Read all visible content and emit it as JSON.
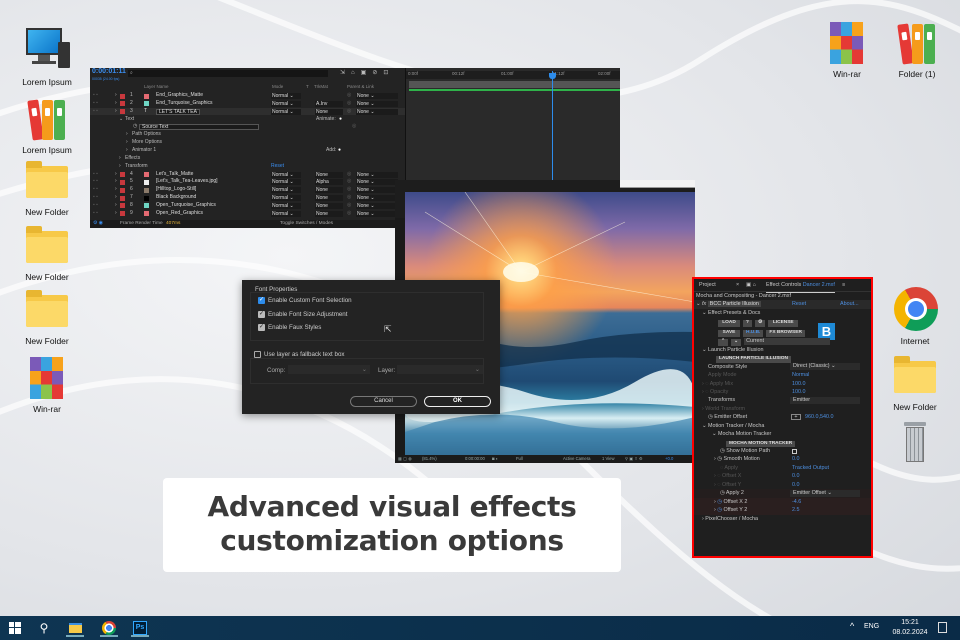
{
  "desktop": {
    "left_icons": [
      {
        "label": "Lorem Ipsum",
        "icon": "computer-icon"
      },
      {
        "label": "Lorem Ipsum",
        "icon": "binders-icon"
      },
      {
        "label": "New Folder",
        "icon": "folder-icon"
      },
      {
        "label": "New Folder",
        "icon": "folder-icon"
      },
      {
        "label": "New Folder",
        "icon": "folder-icon"
      },
      {
        "label": "Win-rar",
        "icon": "winrar-icon"
      }
    ],
    "right_icons": [
      {
        "label": "Win-rar",
        "icon": "winrar-icon"
      },
      {
        "label": "Folder (1)",
        "icon": "binders-icon"
      },
      {
        "label": "Internet",
        "icon": "chrome-icon"
      },
      {
        "label": "New Folder",
        "icon": "folder-icon"
      },
      {
        "label": "",
        "icon": "recycle-bin-icon"
      }
    ]
  },
  "timeline": {
    "timecode": "0:00:01:11",
    "fps": "00035 (24.00 fps)",
    "columns": {
      "layer_name": "Layer Name",
      "mode": "Mode",
      "t": "T",
      "trkmat": "TrkMat",
      "parent": "Parent & Link"
    },
    "ruler": [
      "0:00f",
      "00:12f",
      "01:00f",
      "01:12f",
      "02:00f"
    ],
    "rows": [
      {
        "type": "layer",
        "num": "1",
        "name": "End_Graphics_Matte",
        "mode": "Normal",
        "trkmat": "",
        "parent": "None",
        "color": "#e46a72"
      },
      {
        "type": "layer",
        "num": "2",
        "name": "End_Turquoise_Graphics",
        "mode": "Normal",
        "trkmat": "A.Inv",
        "parent": "None",
        "color": "#6fd6c4"
      },
      {
        "type": "layer",
        "num": "3",
        "name": "LET'S TALK TEA",
        "mode": "Normal",
        "trkmat": "None",
        "parent": "None",
        "color": "text"
      },
      {
        "type": "prop",
        "indent": 1,
        "name": "Text",
        "extra": "Animate:"
      },
      {
        "type": "prop",
        "indent": 3,
        "name": "Source Text"
      },
      {
        "type": "prop",
        "indent": 2,
        "name": "Path Options"
      },
      {
        "type": "prop",
        "indent": 2,
        "name": "More Options"
      },
      {
        "type": "prop",
        "indent": 2,
        "name": "Animator 1",
        "extra": "Add:"
      },
      {
        "type": "prop",
        "indent": 1,
        "name": "Effects"
      },
      {
        "type": "prop",
        "indent": 1,
        "name": "Transform",
        "extra": "Reset"
      },
      {
        "type": "layer",
        "num": "4",
        "name": "Let's_Talk_Matte",
        "mode": "Normal",
        "trkmat": "None",
        "parent": "None",
        "color": "#e46a72"
      },
      {
        "type": "layer",
        "num": "5",
        "name": "[Let's_Talk_Tea-Leaves.jpg]",
        "mode": "Normal",
        "trkmat": "Alpha",
        "parent": "None",
        "color": "#eee"
      },
      {
        "type": "layer",
        "num": "6",
        "name": "[Hilltop_Logo-Still]",
        "mode": "Normal",
        "trkmat": "None",
        "parent": "None",
        "color": "#8a7a6a"
      },
      {
        "type": "layer",
        "num": "7",
        "name": "Black Background",
        "mode": "Normal",
        "trkmat": "None",
        "parent": "None",
        "color": "#000"
      },
      {
        "type": "layer",
        "num": "8",
        "name": "Open_Turquoise_Graphics",
        "mode": "Normal",
        "trkmat": "None",
        "parent": "None",
        "color": "#6fd6c4"
      },
      {
        "type": "layer",
        "num": "9",
        "name": "Open_Red_Graphics",
        "mode": "Normal",
        "trkmat": "None",
        "parent": "None",
        "color": "#e46a72"
      }
    ],
    "footer": {
      "render_label": "Frame Render Time",
      "render_time": "407ms",
      "toggle": "Toggle Switches / Modes"
    }
  },
  "viewer": {
    "zoom": "(81.4%)",
    "timecode": "0:00:00:00",
    "resolution": "Full",
    "camera": "Active Camera",
    "views": "1 View",
    "exposure": "+0.0"
  },
  "dialog": {
    "section": "Font Properties",
    "options": [
      {
        "label": "Enable Custom Font Selection",
        "checked": true
      },
      {
        "label": "Enable Font Size Adjustment",
        "checked": true
      },
      {
        "label": "Enable Faux Styles",
        "checked": true
      }
    ],
    "fallback": {
      "label": "Use layer as fallback text box",
      "checked": false
    },
    "comp_label": "Comp:",
    "layer_label": "Layer:",
    "cancel": "Cancel",
    "ok": "OK"
  },
  "effect_controls": {
    "tab_project": "Project",
    "tab_effect": "Effect Controls",
    "tab_file": "Dancer 2.mxf",
    "comp_line": "Mocha and Compositing - Dancer 2.mxf",
    "effect_name": "BCC Particle Illusion",
    "reset": "Reset",
    "about": "About...",
    "presets_group": "Effect Presets & Docs",
    "buttons_row1": [
      "LOAD",
      "?",
      "⚙",
      "LICENSE"
    ],
    "buttons_row2": [
      "SAVE",
      "H.U.B.",
      "FX BROWSER"
    ],
    "preset_current": "Current",
    "logo": "B",
    "launch_group": "Launch Particle Illusion",
    "launch_button": "LAUNCH PARTICLE ILLUSION",
    "composite_style": {
      "label": "Composite Style",
      "value": "Direct (Classic)"
    },
    "apply_mode": {
      "label": "Apply Mode",
      "value": "Normal"
    },
    "apply_mix": {
      "label": "Apply Mix",
      "value": "100.0"
    },
    "opacity": {
      "label": "Opacity",
      "value": "100.0"
    },
    "transforms": {
      "label": "Transforms",
      "value": "Emitter"
    },
    "world_transform": "World Transform",
    "emitter_offset": {
      "label": "Emitter Offset",
      "value": "960.0,540.0"
    },
    "motion_group": "Motion Tracker / Mocha",
    "mocha_group": "Mocha Motion Tracker",
    "mocha_button": "MOCHA MOTION TRACKER",
    "show_motion_path": "Show Motion Path",
    "smooth_motion": {
      "label": "Smooth Motion",
      "value": "0.0"
    },
    "apply": {
      "label": "Apply",
      "value": "Tracked Output"
    },
    "offset_x": {
      "label": "Offset X",
      "value": "0.0"
    },
    "offset_y": {
      "label": "Offset Y",
      "value": "0.0"
    },
    "apply2": {
      "label": "Apply 2",
      "value": "Emitter Offset"
    },
    "offset_x2": {
      "label": "Offset X 2",
      "value": "-4.6"
    },
    "offset_y2": {
      "label": "Offset Y 2",
      "value": "2.5"
    },
    "pixelchooser": "PixelChooser / Mocha"
  },
  "caption": {
    "line1": "Advanced visual effects",
    "line2": "customization options"
  },
  "taskbar": {
    "apps": [
      "start-icon",
      "search-icon",
      "file-explorer-icon",
      "chrome-icon",
      "photoshop-icon"
    ],
    "ps_label": "Ps",
    "lang": "ENG",
    "time": "15:21",
    "date": "08.02.2024"
  },
  "colors": {
    "accent_blue": "#2d8ceb",
    "highlight_red": "#ff0000",
    "taskbar": "#0b2c48"
  }
}
